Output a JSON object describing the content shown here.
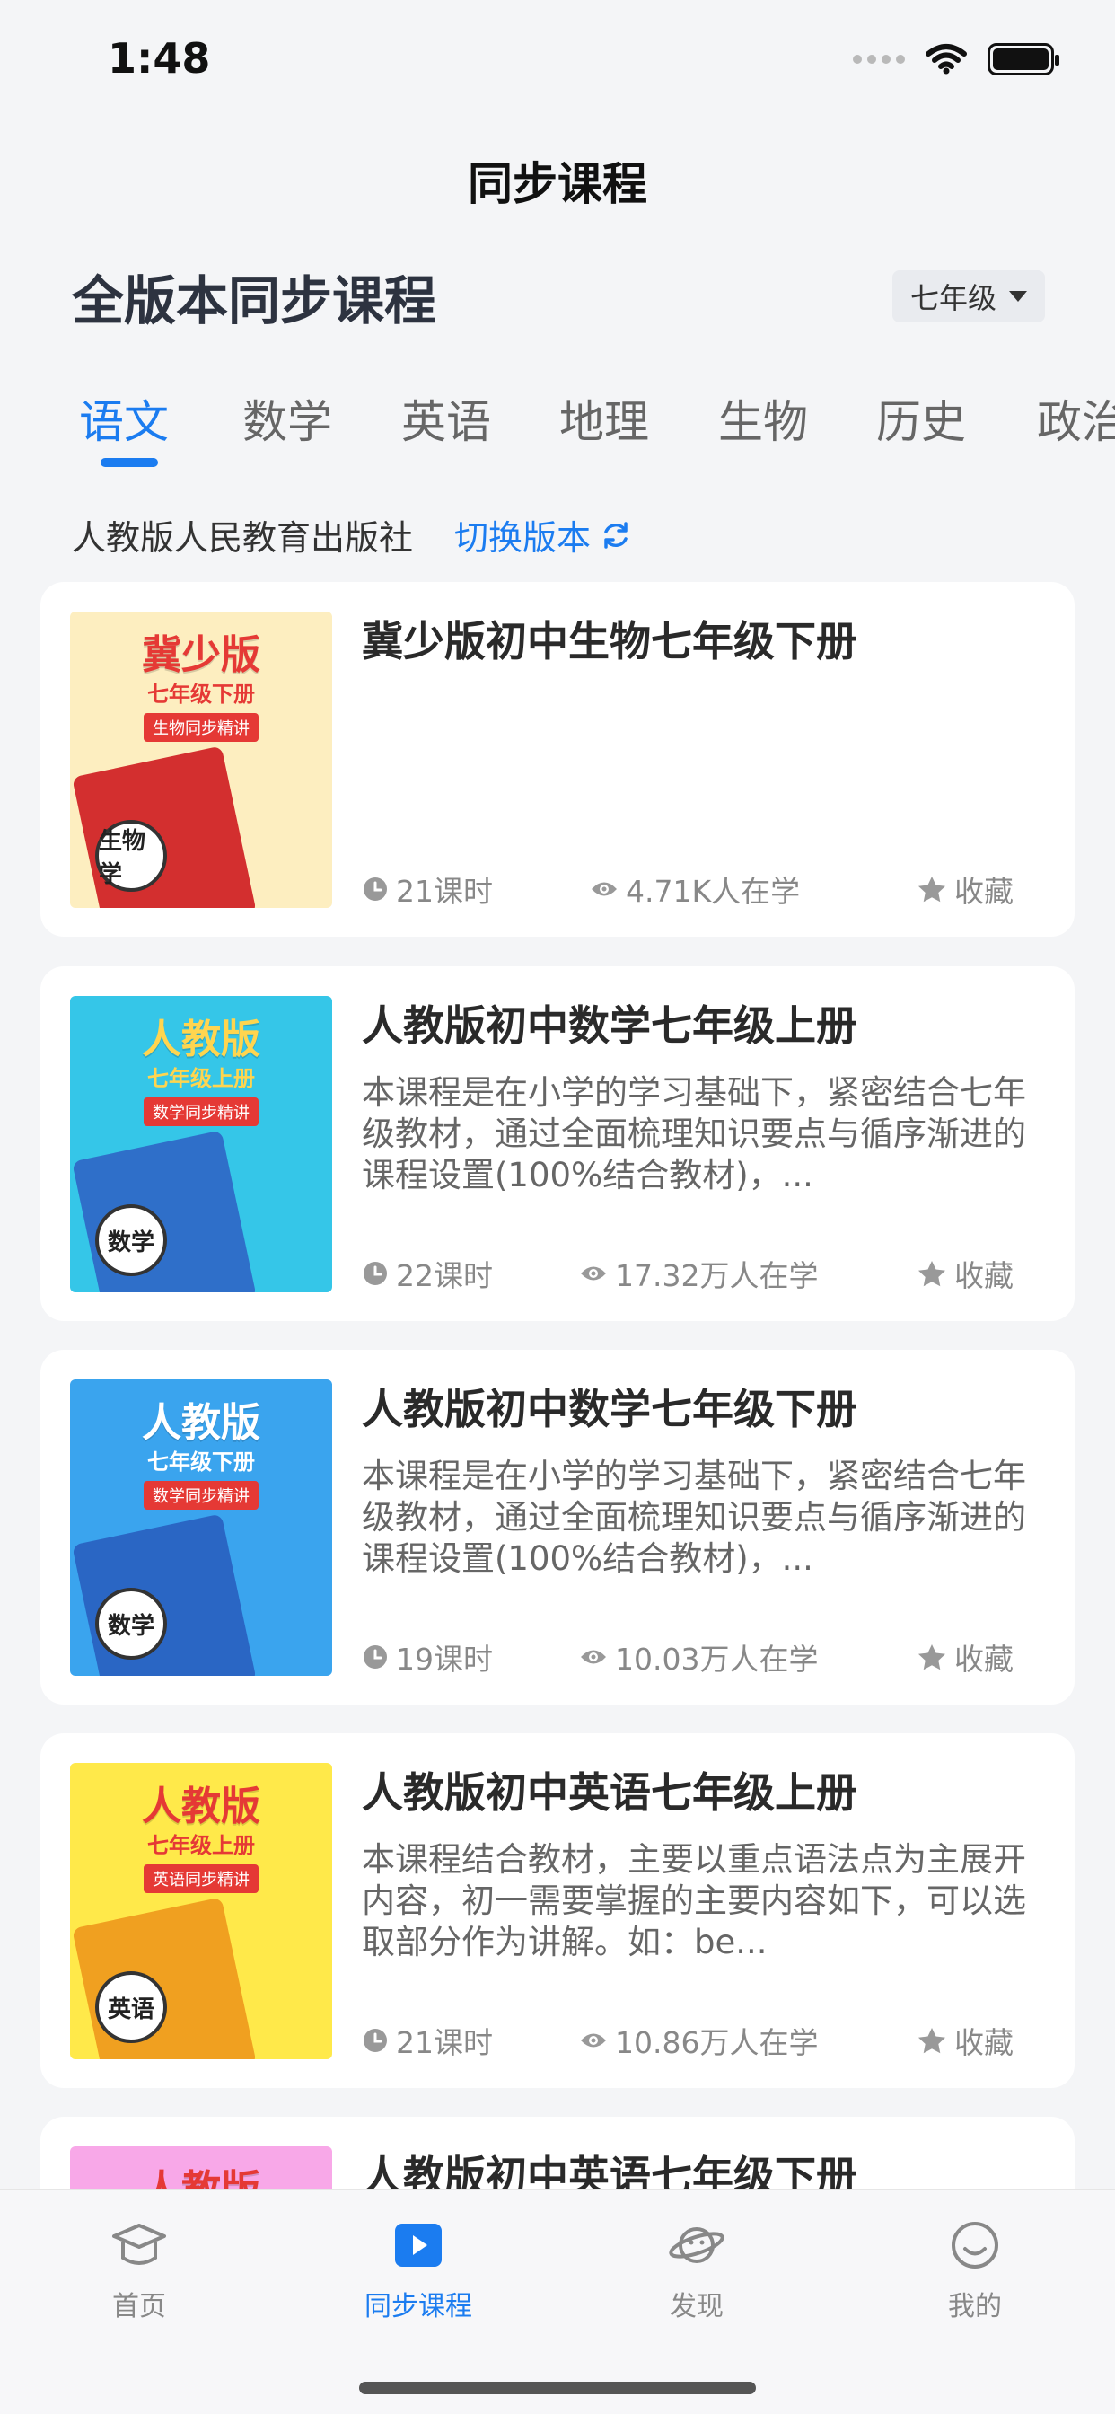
{
  "status_bar": {
    "time": "1:48"
  },
  "nav": {
    "title": "同步课程"
  },
  "section": {
    "title": "全版本同步课程",
    "grade": "七年级"
  },
  "subjects": [
    "语文",
    "数学",
    "英语",
    "地理",
    "生物",
    "历史",
    "政治"
  ],
  "active_subject_index": 0,
  "edition": {
    "name": "人教版人民教育出版社",
    "switch_label": "切换版本"
  },
  "courses": [
    {
      "title": "冀少版初中生物七年级下册",
      "desc": "",
      "lessons": "21课时",
      "learners": "4.71K人在学",
      "favorite": "收藏",
      "cover": {
        "brand": "冀少版",
        "grade": "七年级下册",
        "tag": "生物同步精讲",
        "badge": "生物学",
        "bg": "#fdeec0",
        "title_color": "#e53935",
        "book_color": "#d32f2f"
      }
    },
    {
      "title": "人教版初中数学七年级上册",
      "desc": "本课程是在小学的学习基础下，紧密结合七年级教材，通过全面梳理知识要点与循序渐进的课程设置(100%结合教材)，...",
      "lessons": "22课时",
      "learners": "17.32万人在学",
      "favorite": "收藏",
      "cover": {
        "brand": "人教版",
        "grade": "七年级上册",
        "tag": "数学同步精讲",
        "badge": "数学",
        "bg": "#35c6e8",
        "title_color": "#ffd54f",
        "book_color": "#2f6fc9"
      }
    },
    {
      "title": "人教版初中数学七年级下册",
      "desc": "本课程是在小学的学习基础下，紧密结合七年级教材，通过全面梳理知识要点与循序渐进的课程设置(100%结合教材)，...",
      "lessons": "19课时",
      "learners": "10.03万人在学",
      "favorite": "收藏",
      "cover": {
        "brand": "人教版",
        "grade": "七年级下册",
        "tag": "数学同步精讲",
        "badge": "数学",
        "bg": "#3aa4ee",
        "title_color": "#ffffff",
        "book_color": "#2a66c4"
      }
    },
    {
      "title": "人教版初中英语七年级上册",
      "desc": "本课程结合教材，主要以重点语法点为主展开内容，初一需要掌握的主要内容如下，可以选取部分作为讲解。如：be...",
      "lessons": "21课时",
      "learners": "10.86万人在学",
      "favorite": "收藏",
      "cover": {
        "brand": "人教版",
        "grade": "七年级上册",
        "tag": "英语同步精讲",
        "badge": "英语",
        "bg": "#ffe94a",
        "title_color": "#e53935",
        "book_color": "#f0a020"
      }
    },
    {
      "title": "人教版初中英语七年级下册",
      "desc": "",
      "lessons": "",
      "learners": "",
      "favorite": "",
      "cover": {
        "brand": "人教版",
        "grade": "",
        "tag": "",
        "badge": "",
        "bg": "#f8a8e8",
        "title_color": "#e53935",
        "book_color": "#c060c0"
      }
    }
  ],
  "tab_bar": [
    {
      "label": "首页",
      "icon": "graduation-cap-icon"
    },
    {
      "label": "同步课程",
      "icon": "play-icon"
    },
    {
      "label": "发现",
      "icon": "planet-icon"
    },
    {
      "label": "我的",
      "icon": "smile-icon"
    }
  ],
  "active_tab_index": 1,
  "colors": {
    "accent": "#1b7cf0",
    "background": "#f4f5f7"
  }
}
